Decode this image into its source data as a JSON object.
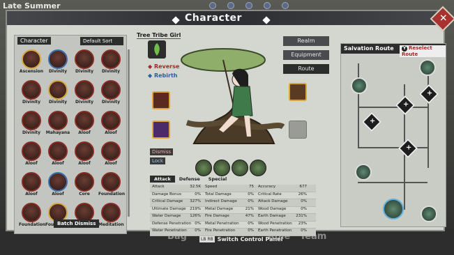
{
  "season": "Late Summer",
  "title": "Character",
  "left_panel": {
    "label": "Character",
    "sort": "Default Sort",
    "characters": [
      {
        "name": "Ascension"
      },
      {
        "name": "Divinity"
      },
      {
        "name": "Divinity"
      },
      {
        "name": "Divinity"
      },
      {
        "name": "Divinity"
      },
      {
        "name": "Divinity"
      },
      {
        "name": "Divinity"
      },
      {
        "name": "Divinity"
      },
      {
        "name": "Divinity"
      },
      {
        "name": "Mahayana"
      },
      {
        "name": "Aloof"
      },
      {
        "name": "Aloof"
      },
      {
        "name": "Aloof"
      },
      {
        "name": "Aloof"
      },
      {
        "name": "Aloof"
      },
      {
        "name": "Aloof"
      },
      {
        "name": "Aloof"
      },
      {
        "name": "Aloof"
      },
      {
        "name": "Core"
      },
      {
        "name": "Foundation"
      },
      {
        "name": "Foundation"
      },
      {
        "name": "Foundation"
      },
      {
        "name": "Meditation"
      },
      {
        "name": "Meditation"
      }
    ],
    "batch_dismiss": "Batch Dismiss"
  },
  "character": {
    "name": "Tree Tribe Girl",
    "reverse": "Reverse",
    "rebirth": "Rebirth",
    "dismiss": "Dismiss",
    "lock": "Lock"
  },
  "tabs": [
    "Realm",
    "Equipment",
    "Route"
  ],
  "stats": {
    "tabs": [
      "Attack",
      "Defense",
      "Special"
    ],
    "rows": [
      [
        [
          "Attack",
          "32.5K"
        ],
        [
          "Speed",
          "75"
        ],
        [
          "Accuracy",
          "677"
        ]
      ],
      [
        [
          "Damage Bonus",
          "0%"
        ],
        [
          "Total Damage",
          "0%"
        ],
        [
          "Critical Rate",
          "26%"
        ]
      ],
      [
        [
          "Critical Damage",
          "327%"
        ],
        [
          "Indirect Damage",
          "0%"
        ],
        [
          "Attack Damage",
          "0%"
        ]
      ],
      [
        [
          "Ultimate Damage",
          "219%"
        ],
        [
          "Metal Damage",
          "21%"
        ],
        [
          "Wood Damage",
          "0%"
        ]
      ],
      [
        [
          "Water Damage",
          "126%"
        ],
        [
          "Fire Damage",
          "47%"
        ],
        [
          "Earth Damage",
          "231%"
        ]
      ],
      [
        [
          "Defense Penetration",
          "0%"
        ],
        [
          "Metal Penetration",
          "0%"
        ],
        [
          "Wood Penetration",
          "23%"
        ]
      ],
      [
        [
          "Water Penetration",
          "0%"
        ],
        [
          "Fire Penetration",
          "0%"
        ],
        [
          "Earth Penetration",
          "0%"
        ]
      ]
    ]
  },
  "route": {
    "title": "Salvation Route",
    "reselect_key": "Y",
    "reselect": "Reselect Route"
  },
  "bottom_nav": [
    "Bag",
    "Role",
    "Team"
  ],
  "switch": {
    "key": "LB RB",
    "label": "Switch Control Panel"
  },
  "colors": {
    "accent_red": "#a52828",
    "panel": "#d4d6d0",
    "dark": "#2d2d2d"
  }
}
